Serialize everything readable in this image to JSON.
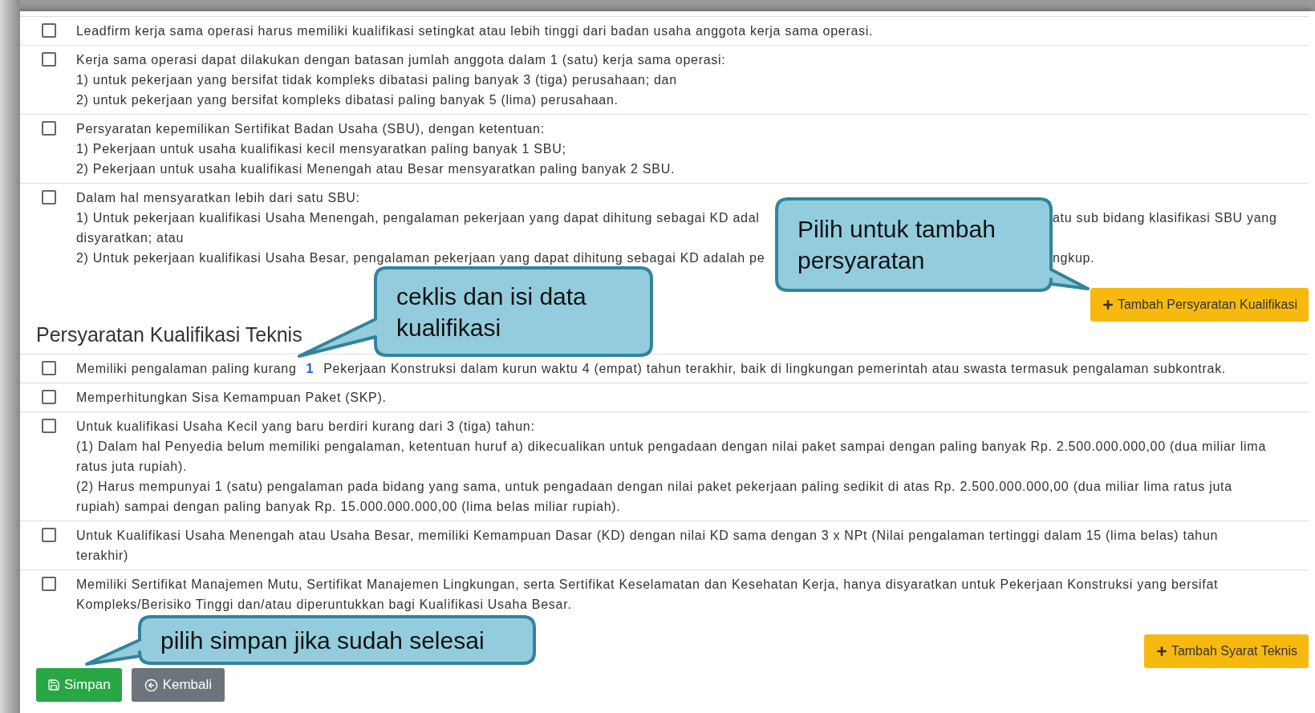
{
  "kualifikasi_items": [
    {
      "kind": "text",
      "checked": false,
      "lines": [
        [
          "Leadfirm kerja sama operasi harus memiliki kualifikasi setingkat atau lebih tinggi dari badan usaha anggota kerja sama operasi."
        ]
      ]
    },
    {
      "kind": "text",
      "checked": false,
      "lines": [
        [
          "Kerja sama operasi dapat dilakukan dengan batasan jumlah anggota dalam 1 (satu) kerja sama operasi:"
        ],
        [
          "1) untuk pekerjaan yang bersifat tidak kompleks dibatasi paling banyak 3 (tiga) perusahaan; dan"
        ],
        [
          "2) untuk pekerjaan yang bersifat kompleks dibatasi paling banyak 5 (lima) perusahaan."
        ]
      ]
    },
    {
      "kind": "text",
      "checked": false,
      "lines": [
        [
          "Persyaratan kepemilikan Sertifikat Badan Usaha (SBU), dengan ketentuan:"
        ],
        [
          "1) Pekerjaan untuk usaha kualifikasi kecil mensyaratkan paling banyak 1 SBU;"
        ],
        [
          "2) Pekerjaan untuk usaha kualifikasi Menengah atau Besar mensyaratkan paling banyak 2 SBU."
        ]
      ]
    },
    {
      "kind": "text",
      "checked": false,
      "lines": [
        [
          "Dalam hal mensyaratkan lebih dari satu SBU:"
        ],
        [
          "1) Untuk pekerjaan kualifikasi Usaha Menengah, pengalaman pekerjaan yang dapat dihitung sebagai KD adal",
          "atu sub bidang klasifikasi SBU yang"
        ],
        [
          "disyaratkan; atau"
        ],
        [
          "2) Untuk pekerjaan kualifikasi Usaha Besar, pengalaman pekerjaan yang dapat dihitung sebagai KD adalah pe",
          "ngkup."
        ]
      ]
    }
  ],
  "add_kualifikasi_button": "Tambah Persyaratan Kualifikasi",
  "teknis_heading": "Persyaratan Kualifikasi Teknis",
  "teknis_items": [
    {
      "kind": "input",
      "checked": false,
      "before": "Memiliki pengalaman paling kurang",
      "value": "1",
      "after": "Pekerjaan Konstruksi dalam kurun waktu 4 (empat) tahun terakhir, baik di lingkungan pemerintah atau swasta termasuk pengalaman subkontrak."
    },
    {
      "kind": "text",
      "checked": false,
      "lines": [
        [
          "Memperhitungkan Sisa Kemampuan Paket (SKP)."
        ]
      ]
    },
    {
      "kind": "text",
      "checked": false,
      "lines": [
        [
          "Untuk kualifikasi Usaha Kecil yang baru berdiri kurang dari 3 (tiga) tahun:"
        ],
        [
          "(1) Dalam hal Penyedia belum memiliki pengalaman, ketentuan huruf a) dikecualikan untuk pengadaan dengan nilai paket sampai dengan paling banyak Rp. 2.500.000.000,00 (dua miliar lima"
        ],
        [
          "ratus juta rupiah)."
        ],
        [
          "(2) Harus mempunyai 1 (satu) pengalaman pada bidang yang sama, untuk pengadaan dengan nilai paket pekerjaan paling sedikit di atas Rp. 2.500.000.000,00 (dua miliar lima ratus juta"
        ],
        [
          "rupiah) sampai dengan paling banyak Rp. 15.000.000.000,00 (lima belas miliar rupiah)."
        ]
      ]
    },
    {
      "kind": "text",
      "checked": false,
      "lines": [
        [
          "Untuk Kualifikasi Usaha Menengah atau Usaha Besar, memiliki Kemampuan Dasar (KD) dengan nilai KD sama dengan 3 x NPt (Nilai pengalaman tertinggi dalam 15 (lima belas) tahun"
        ],
        [
          "terakhir)"
        ]
      ]
    },
    {
      "kind": "text",
      "checked": false,
      "lines": [
        [
          "Memiliki Sertifikat Manajemen Mutu, Sertifikat Manajemen Lingkungan, serta Sertifikat Keselamatan dan Kesehatan Kerja, hanya disyaratkan untuk Pekerjaan Konstruksi yang bersifat"
        ],
        [
          "Kompleks/Berisiko Tinggi dan/atau diperuntukkan bagi Kualifikasi Usaha Besar."
        ]
      ]
    }
  ],
  "add_teknis_button": "Tambah Syarat Teknis",
  "save_button": "Simpan",
  "back_button": "Kembali",
  "callouts": [
    {
      "text": "Pilih untuk tambah persyaratan"
    },
    {
      "text": "ceklis dan isi data kualifikasi"
    },
    {
      "text": "pilih simpan jika sudah selesai"
    }
  ]
}
